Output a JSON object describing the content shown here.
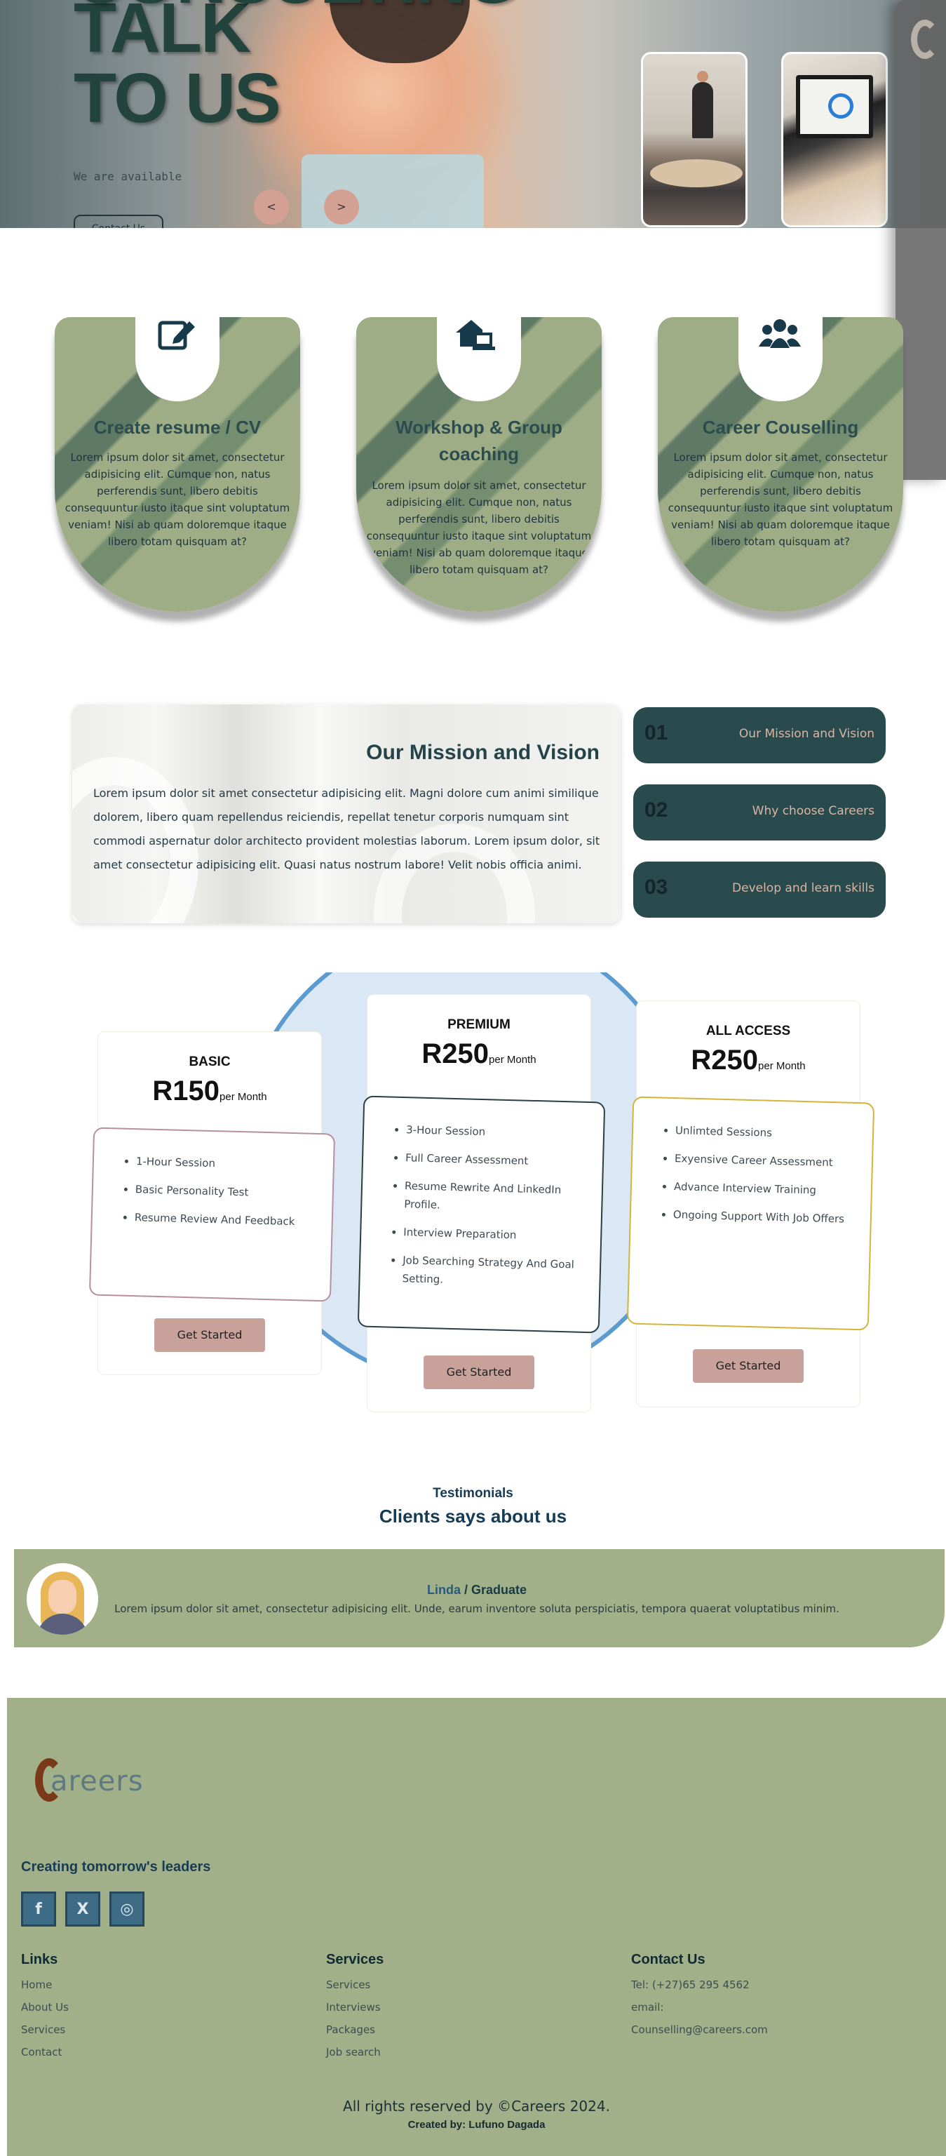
{
  "hero": {
    "title_line0": "CONSULTING",
    "title_line1": "TALK",
    "title_line2": "TO US",
    "subtitle": "We are available",
    "cta_label": "Contact Us",
    "prev_label": "<",
    "next_label": ">"
  },
  "services": [
    {
      "title": "Create resume / CV",
      "icon": "edit-icon",
      "description": "Lorem ipsum dolor sit amet, consectetur adipisicing elit. Cumque non, natus perferendis sunt, libero debitis consequuntur iusto itaque sint voluptatum veniam! Nisi ab quam doloremque itaque libero totam quisquam at?"
    },
    {
      "title": "Workshop & Group coaching",
      "icon": "home-laptop-icon",
      "description": "Lorem ipsum dolor sit amet, consectetur adipisicing elit. Cumque non, natus perferendis sunt, libero debitis consequuntur iusto itaque sint voluptatum veniam! Nisi ab quam doloremque itaque libero totam quisquam at?"
    },
    {
      "title": "Career Couselling",
      "icon": "users-icon",
      "description": "Lorem ipsum dolor sit amet, consectetur adipisicing elit. Cumque non, natus perferendis sunt, libero debitis consequuntur iusto itaque sint voluptatum veniam! Nisi ab quam doloremque itaque libero totam quisquam at?"
    }
  ],
  "mission": {
    "title": "Our Mission and Vision",
    "text": "Lorem ipsum dolor sit amet consectetur adipisicing elit. Magni dolore cum animi similique dolorem, libero quam repellendus reiciendis, repellat tenetur corporis numquam sint commodi aspernatur dolor architecto provident molestias laborum. Lorem ipsum dolor, sit amet consectetur adipisicing elit. Quasi natus nostrum labore! Velit nobis officia animi.",
    "tabs": [
      {
        "num": "01",
        "label": "Our Mission and Vision"
      },
      {
        "num": "02",
        "label": "Why choose Careers"
      },
      {
        "num": "03",
        "label": "Develop and learn skills"
      }
    ]
  },
  "pricing": {
    "per": "per Month",
    "cta": "Get Started",
    "plans": [
      {
        "name": "BASIC",
        "price": "R150",
        "features": [
          "1-Hour Session",
          "Basic Personality Test",
          "Resume Review And Feedback"
        ]
      },
      {
        "name": "PREMIUM",
        "price": "R250",
        "features": [
          "3-Hour Session",
          "Full Career Assessment",
          "Resume Rewrite And LinkedIn Profile.",
          "Interview Preparation",
          "Job Searching Strategy And Goal Setting."
        ]
      },
      {
        "name": "ALL ACCESS",
        "price": "R250",
        "features": [
          "Unlimted Sessions",
          "Exyensive Career Assessment",
          "Advance Interview Training",
          "Ongoing Support With Job Offers"
        ]
      }
    ],
    "colors": {
      "basic": "#b88fa0",
      "premium": "#2a3f44",
      "all_access": "#d4b43a"
    }
  },
  "testimonials": {
    "subtitle": "Testimonials",
    "title": "Clients says about us",
    "name": "Linda",
    "role": "Graduate",
    "separator": " / ",
    "text": "Lorem ipsum dolor sit amet, consectetur adipisicing elit. Unde, earum inventore soluta perspiciatis, tempora quaerat voluptatibus minim."
  },
  "footer": {
    "logo_text": "areers",
    "tagline": "Creating tomorrow's leaders",
    "social": [
      {
        "icon": "facebook-icon",
        "glyph": "f"
      },
      {
        "icon": "x-icon",
        "glyph": "X"
      },
      {
        "icon": "instagram-icon",
        "glyph": "◎"
      }
    ],
    "links_title": "Links",
    "links": [
      "Home",
      "About Us",
      "Services",
      "Contact"
    ],
    "services_title": "Services",
    "services": [
      "Services",
      "Interviews",
      "Packages",
      "Job search"
    ],
    "contact_title": "Contact Us",
    "contact": [
      "Tel: (+27)65 295 4562",
      "email:",
      "Counselling@careers.com"
    ],
    "copyright": "All rights reserved by ©Careers 2024.",
    "credit": "Created by: Lufuno Dagada"
  }
}
